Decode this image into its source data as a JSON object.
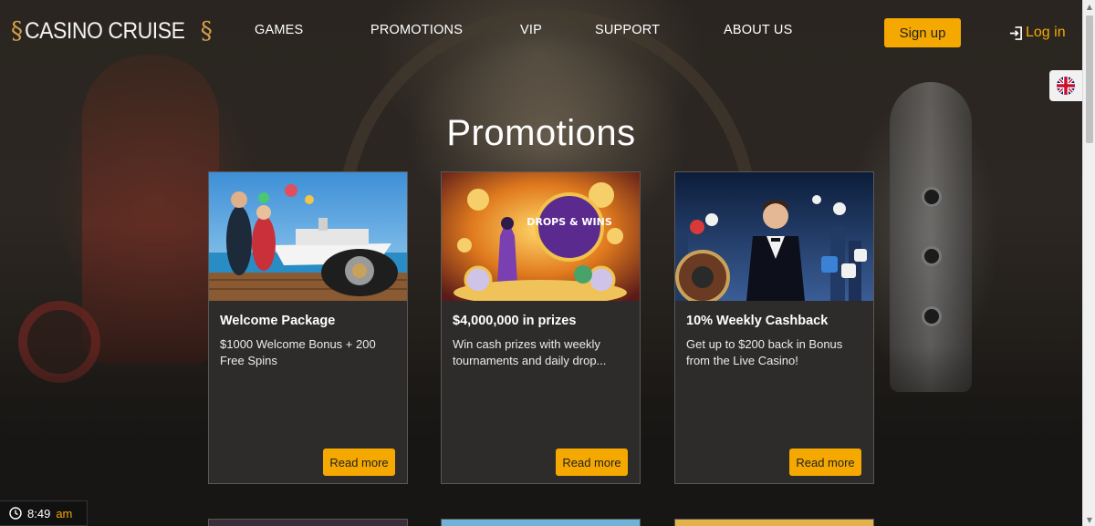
{
  "brand": {
    "logo_text": "CASINO CRUISE",
    "logo_left_swirl": "§",
    "logo_right_swirl": "§"
  },
  "nav": {
    "items": [
      {
        "label": "GAMES"
      },
      {
        "label": "PROMOTIONS"
      },
      {
        "label": "VIP"
      },
      {
        "label": "SUPPORT"
      },
      {
        "label": "ABOUT US"
      }
    ]
  },
  "auth": {
    "signup_label": "Sign up",
    "login_label": "Log in"
  },
  "language": {
    "icon": "uk-flag-icon"
  },
  "page": {
    "title": "Promotions"
  },
  "promotions": [
    {
      "title": "Welcome Package",
      "description": "$1000 Welcome Bonus + 200 Free Spins",
      "button": "Read more"
    },
    {
      "title": "$4,000,000 in prizes",
      "description": "Win cash prizes with weekly tournaments and daily drop...",
      "button": "Read more",
      "image_text": "DROPS & WINS"
    },
    {
      "title": "10% Weekly Cashback",
      "description": "Get up to $200 back in Bonus from the Live Casino!",
      "button": "Read more"
    }
  ],
  "clock": {
    "time": "8:49",
    "ampm": "am"
  },
  "colors": {
    "accent": "#f5a800",
    "card_bg": "#2d2c2b",
    "card_border": "#5a5855"
  }
}
